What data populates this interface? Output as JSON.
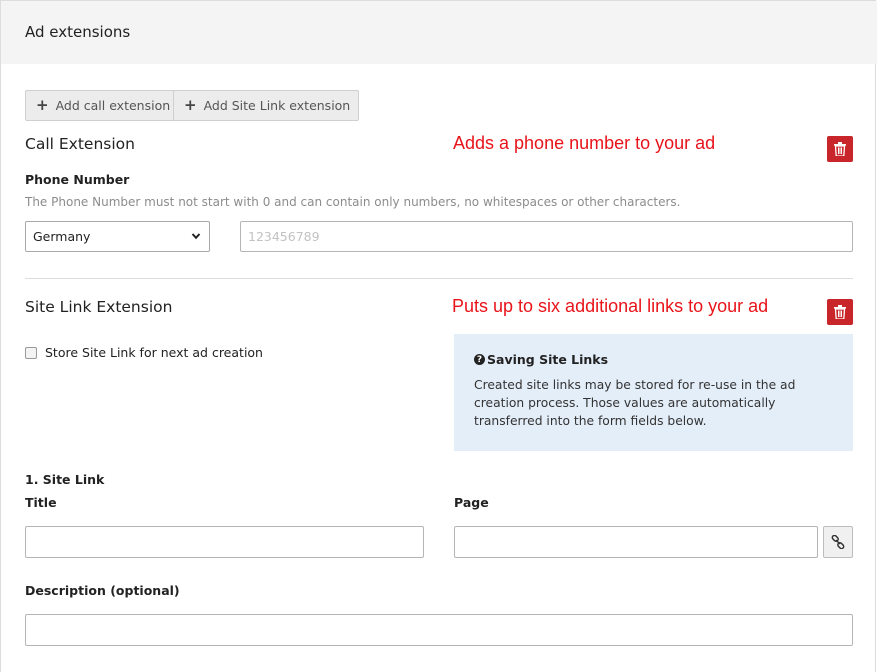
{
  "header": {
    "title": "Ad extensions"
  },
  "toolbar": {
    "add_call_label": "Add call extension",
    "add_sitelink_label": "Add Site Link extension"
  },
  "call_extension": {
    "title": "Call Extension",
    "annotation": "Adds a phone number to your ad",
    "phone_label": "Phone Number",
    "phone_help": "The Phone Number must not start with 0 and can contain only numbers, no whitespaces or other characters.",
    "country_selected": "Germany",
    "phone_placeholder": "123456789",
    "phone_value": ""
  },
  "sitelink_extension": {
    "title": "Site Link Extension",
    "annotation": "Puts up to six additional links to your ad",
    "store_label": "Store Site Link for next ad creation",
    "store_checked": false,
    "info": {
      "title": "Saving Site Links",
      "text": "Created site links may be stored for re-use in the ad creation process. Those values are automatically transferred into the form fields below."
    },
    "links": [
      {
        "heading": "1. Site Link",
        "title_label": "Title",
        "page_label": "Page",
        "description_label": "Description (optional)",
        "title_value": "",
        "page_value": "",
        "description_value": ""
      }
    ]
  },
  "colors": {
    "annotation": "#e8141a",
    "delete_button": "#c8262a",
    "info_box_bg": "#e4eef9",
    "header_bg": "#f4f4f4"
  },
  "icons": {
    "add": "plus-icon",
    "delete": "trash-icon",
    "dropdown": "chevron-down-icon",
    "info": "question-circle-icon",
    "link": "link-icon"
  }
}
